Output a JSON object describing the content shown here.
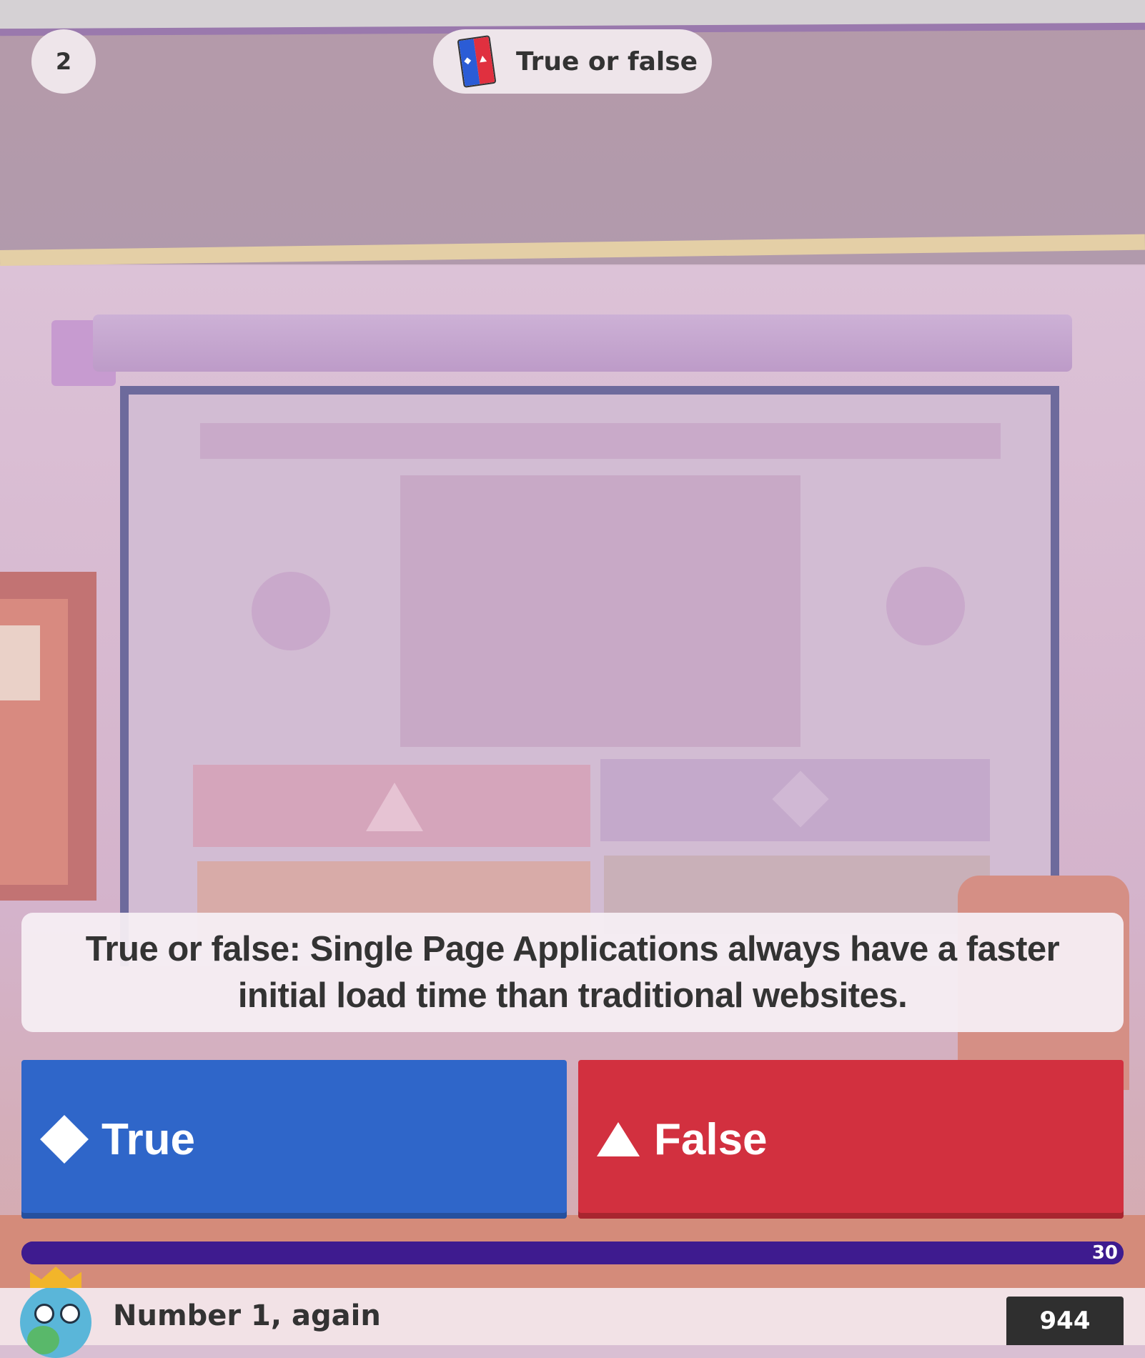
{
  "header": {
    "question_number": "2",
    "question_type_label": "True or false",
    "question_type_icon": "true-false-card-icon"
  },
  "question": {
    "text": "True or false: Single Page Applications always have a faster initial load time than traditional websites."
  },
  "answers": [
    {
      "label": "True",
      "icon": "diamond-icon",
      "color": "#2f66c9"
    },
    {
      "label": "False",
      "icon": "triangle-icon",
      "color": "#d2303f"
    }
  ],
  "timer": {
    "seconds_remaining": "30",
    "progress_fraction": 1.0,
    "color": "#3d1a8c"
  },
  "footer": {
    "player_name": "Number 1, again",
    "score": "944",
    "avatar_icon": "crowned-globe-avatar"
  }
}
